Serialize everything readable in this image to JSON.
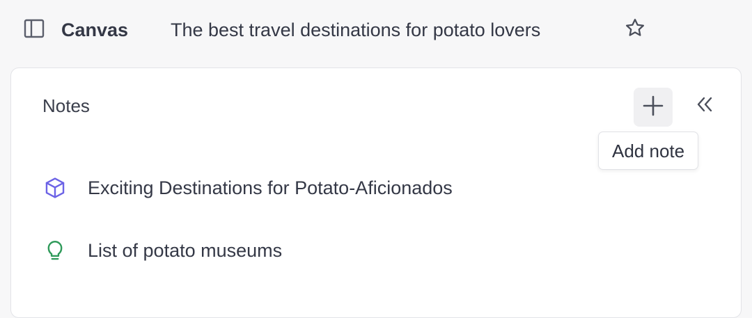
{
  "header": {
    "app_name": "Canvas",
    "doc_title": "The best travel destinations for potato lovers",
    "sidebar_toggle_icon": "sidebar-panel-icon",
    "favorite_icon": "star-outline-icon"
  },
  "notes_panel": {
    "title": "Notes",
    "add_icon": "plus-icon",
    "collapse_icon": "double-chevron-left-icon",
    "tooltip": "Add note",
    "items": [
      {
        "label": "Exciting Destinations for Potato-Aficionados",
        "icon": "cube-icon",
        "icon_color": "#6c63e6"
      },
      {
        "label": "List of potato museums",
        "icon": "lightbulb-icon",
        "icon_color": "#2f9a5a"
      }
    ]
  }
}
